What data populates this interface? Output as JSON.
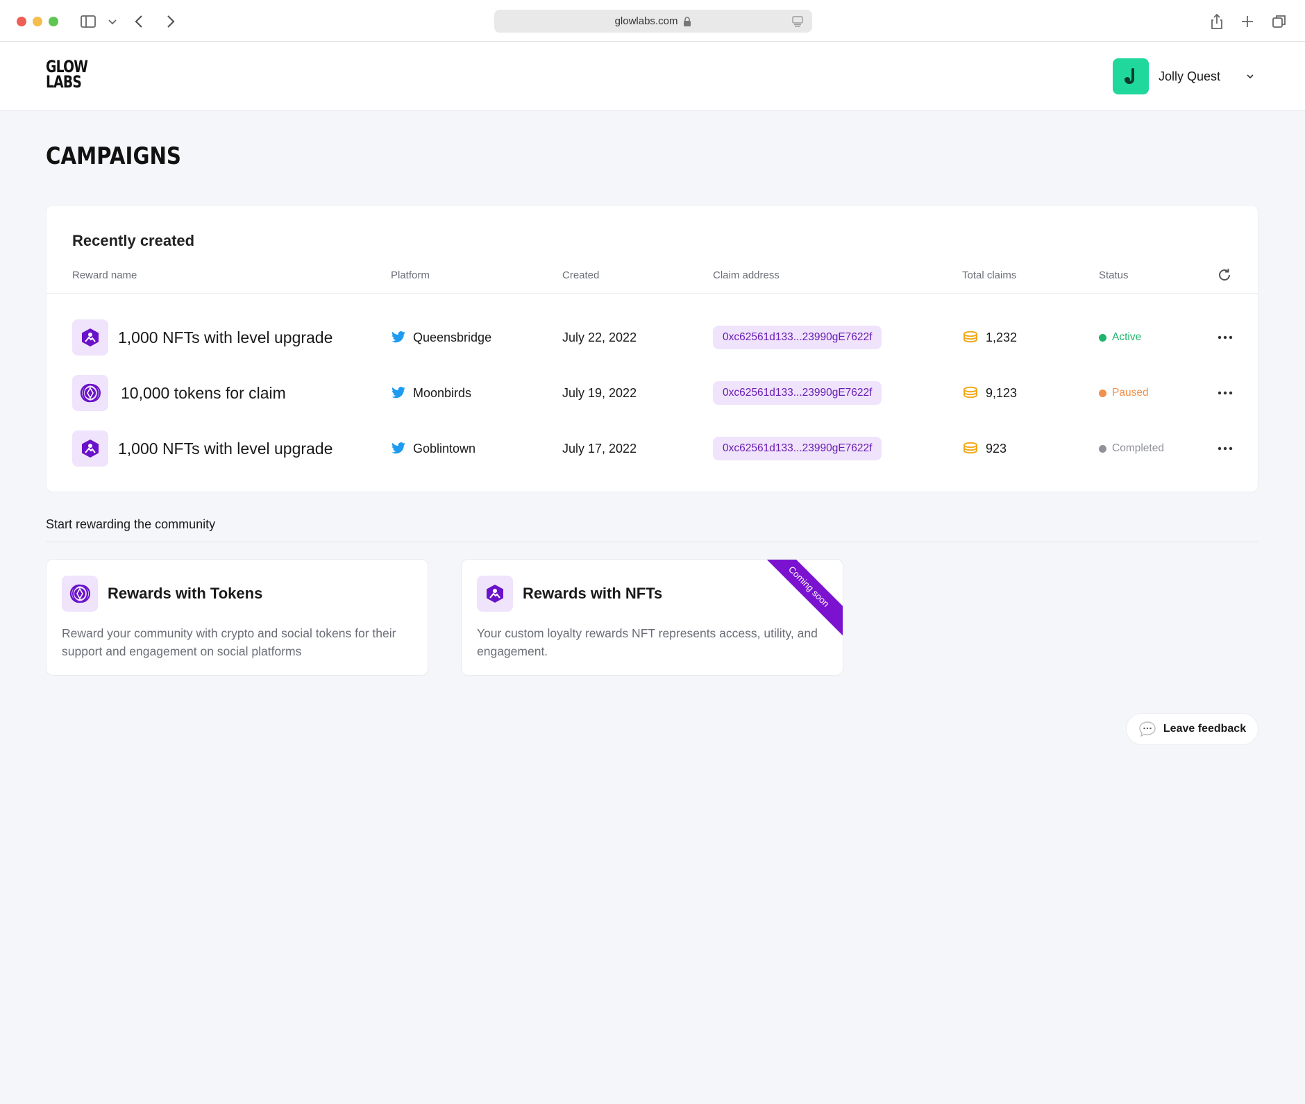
{
  "browser": {
    "url": "glowlabs.com"
  },
  "header": {
    "logo_top": "GLOW",
    "logo_bottom": "LABS",
    "account_name": "Jolly Quest"
  },
  "page": {
    "title": "CAMPAIGNS"
  },
  "recent": {
    "title": "Recently created",
    "columns": [
      "Reward name",
      "Platform",
      "Created",
      "Claim address",
      "Total claims",
      "Status"
    ],
    "rows": [
      {
        "reward": "1,000 NFTs with level upgrade",
        "reward_icon": "nft-icon",
        "platform": "Queensbridge",
        "created": "July 22, 2022",
        "address": "0xc62561d133...23990gE7622f",
        "claims": "1,232",
        "status": "Active",
        "status_color": "#1fb36b"
      },
      {
        "reward": "10,000 tokens for claim",
        "reward_icon": "token-icon",
        "platform": "Moonbirds",
        "created": "July 19, 2022",
        "address": "0xc62561d133...23990gE7622f",
        "claims": "9,123",
        "status": "Paused",
        "status_color": "#f0904a"
      },
      {
        "reward": "1,000 NFTs with level upgrade",
        "reward_icon": "nft-icon",
        "platform": "Goblintown",
        "created": "July 17, 2022",
        "address": "0xc62561d133...23990gE7622f",
        "claims": "923",
        "status": "Completed",
        "status_color": "#8f9299"
      }
    ]
  },
  "start": {
    "label": "Start rewarding the community",
    "cards": [
      {
        "title": "Rewards with Tokens",
        "description": "Reward your community with crypto and social tokens for their support and engagement on social platforms",
        "icon": "token-icon"
      },
      {
        "title": "Rewards with NFTs",
        "description": "Your custom loyalty rewards NFT represents access, utility, and engagement.",
        "icon": "nft-icon",
        "badge": "Coming soon"
      }
    ]
  },
  "feedback": {
    "label": "Leave feedback"
  },
  "colors": {
    "accent": "#7a12cf",
    "avatar": "#20d89b",
    "twitter": "#1d9bf0",
    "coin": "#f2a91c"
  }
}
